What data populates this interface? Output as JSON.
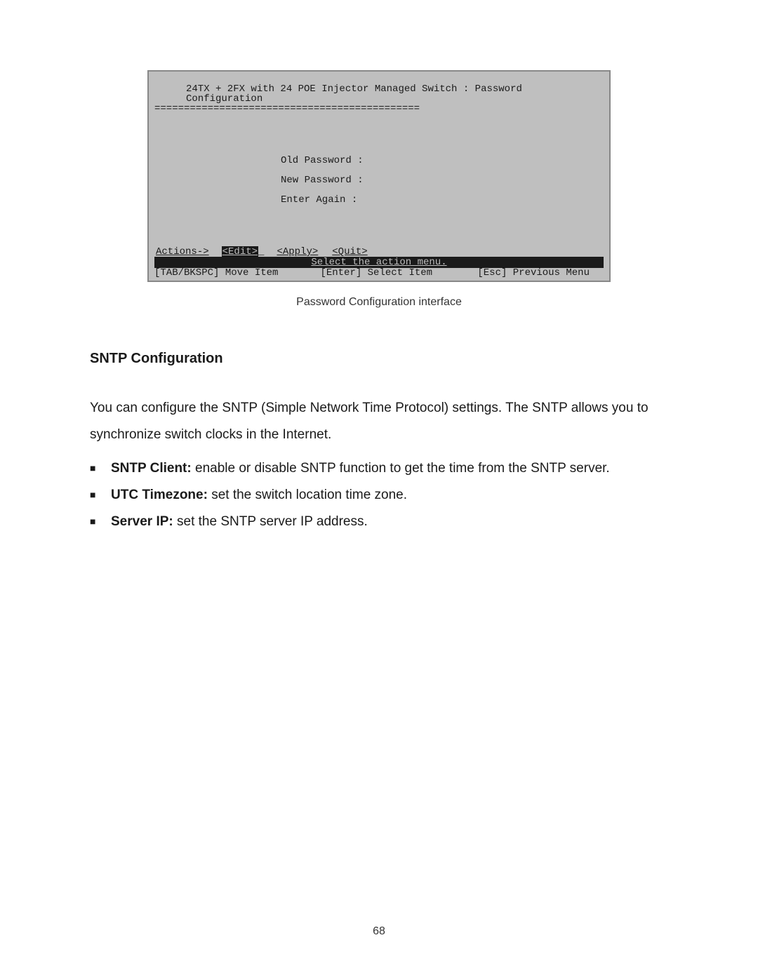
{
  "terminal": {
    "title": "24TX + 2FX with 24 POE Injector Managed Switch : Password Configuration",
    "underline": "=============================================",
    "fields": [
      {
        "label": "Old Password",
        "colon": " :",
        "value": ""
      },
      {
        "label": "New Password",
        "colon": " :",
        "value": ""
      },
      {
        "label": "Enter Again ",
        "colon": " :",
        "value": ""
      }
    ],
    "actions": {
      "prefix": "Actions->",
      "items": [
        {
          "label": "<Edit>",
          "selected": true
        },
        {
          "label": "<Apply>",
          "selected": false
        },
        {
          "label": "<Quit>",
          "selected": false
        }
      ]
    },
    "instruction": "Select the action menu.",
    "footer": {
      "left": "[TAB/BKSPC] Move Item",
      "center": "[Enter] Select Item",
      "right": "[Esc] Previous Menu"
    }
  },
  "caption": "Password Configuration interface",
  "section_heading": "SNTP Configuration",
  "paragraph": "You can configure the SNTP (Simple Network Time Protocol) settings. The SNTP allows you to synchronize switch clocks in the Internet.",
  "bullets": [
    {
      "label": "SNTP Client:",
      "text": " enable or disable SNTP function to get the time from the SNTP server."
    },
    {
      "label": "UTC Timezone:",
      "text": " set the switch location time zone."
    },
    {
      "label": "Server IP:",
      "text": " set the SNTP server IP address."
    }
  ],
  "page_number": "68"
}
